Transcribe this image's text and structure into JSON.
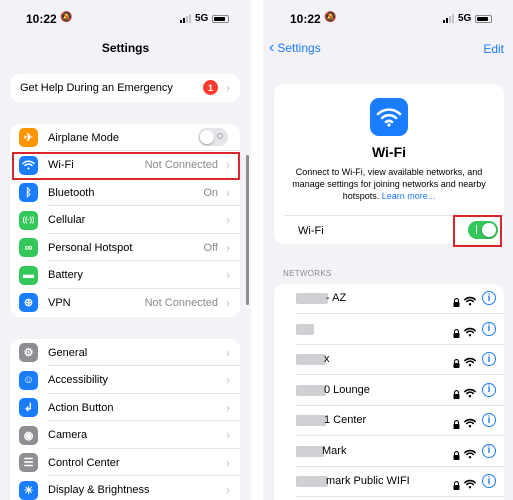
{
  "left": {
    "status": {
      "time": "10:22",
      "network": "5G"
    },
    "title": "Settings",
    "emergency": {
      "label": "Get Help During an Emergency",
      "badge": "1"
    },
    "group1": [
      {
        "name": "airplane-mode",
        "label": "Airplane Mode",
        "value": "",
        "icon": "airplane-icon",
        "color": "#ff9500",
        "glyph": "✈",
        "toggle": "off"
      },
      {
        "name": "wifi",
        "label": "Wi-Fi",
        "value": "Not Connected",
        "icon": "wifi-icon",
        "color": "#1a7cff",
        "glyph": "",
        "toggle": ""
      },
      {
        "name": "bluetooth",
        "label": "Bluetooth",
        "value": "On",
        "icon": "bluetooth-icon",
        "color": "#1a7cff",
        "glyph": "ᛒ",
        "toggle": ""
      },
      {
        "name": "cellular",
        "label": "Cellular",
        "value": "",
        "icon": "cellular-icon",
        "color": "#34c759",
        "glyph": "((·))",
        "toggle": ""
      },
      {
        "name": "personal-hotspot",
        "label": "Personal Hotspot",
        "value": "Off",
        "icon": "hotspot-icon",
        "color": "#34c759",
        "glyph": "∞",
        "toggle": ""
      },
      {
        "name": "battery",
        "label": "Battery",
        "value": "",
        "icon": "battery-icon",
        "color": "#34c759",
        "glyph": "▬",
        "toggle": ""
      },
      {
        "name": "vpn",
        "label": "VPN",
        "value": "Not Connected",
        "icon": "vpn-icon",
        "color": "#1a7cff",
        "glyph": "⊕",
        "toggle": ""
      }
    ],
    "group2": [
      {
        "name": "general",
        "label": "General",
        "icon": "gear-icon",
        "color": "#8e8e93",
        "glyph": "⚙"
      },
      {
        "name": "accessibility",
        "label": "Accessibility",
        "icon": "accessibility-icon",
        "color": "#1a7cff",
        "glyph": "☺"
      },
      {
        "name": "action-button",
        "label": "Action Button",
        "icon": "action-button-icon",
        "color": "#1a7cff",
        "glyph": "↲"
      },
      {
        "name": "camera",
        "label": "Camera",
        "icon": "camera-icon",
        "color": "#8e8e93",
        "glyph": "◉"
      },
      {
        "name": "control-center",
        "label": "Control Center",
        "icon": "control-center-icon",
        "color": "#8e8e93",
        "glyph": "☰"
      },
      {
        "name": "display-brightness",
        "label": "Display & Brightness",
        "icon": "brightness-icon",
        "color": "#1a7cff",
        "glyph": "☀"
      }
    ]
  },
  "right": {
    "status": {
      "time": "10:22",
      "network": "5G"
    },
    "nav": {
      "back": "Settings",
      "edit": "Edit"
    },
    "card": {
      "title": "Wi-Fi",
      "description": "Connect to Wi-Fi, view available networks, and manage settings for joining networks and nearby hotspots.",
      "link": "Learn more...",
      "toggle_label": "Wi-Fi",
      "toggle_state": "on"
    },
    "networks_header": "NETWORKS",
    "networks": [
      {
        "name": "- AZ"
      },
      {
        "name": ""
      },
      {
        "name": "x"
      },
      {
        "name": "0 Lounge"
      },
      {
        "name": "1 Center"
      },
      {
        "name": "Mark"
      },
      {
        "name": "mark Public WIFI"
      }
    ]
  },
  "colors": {
    "accent": "#1a7cff",
    "highlight": "#d9262c",
    "toggle_on": "#34c759",
    "badge": "#ff3b30"
  }
}
